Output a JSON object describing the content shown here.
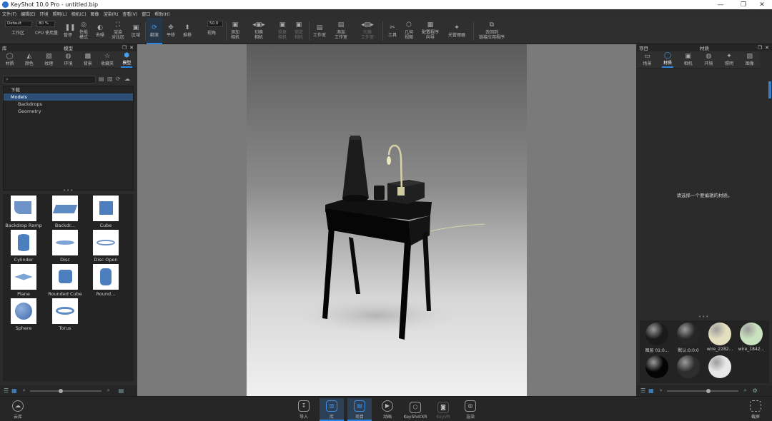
{
  "window": {
    "title": "KeyShot 10.0 Pro  -  untitled.bip",
    "min": "—",
    "max": "❐",
    "close": "✕"
  },
  "menu": [
    "文件(F)",
    "编辑(E)",
    "环境",
    "照明(L)",
    "相机(C)",
    "图像",
    "渲染(R)",
    "查看(V)",
    "窗口",
    "帮助(H)"
  ],
  "toolbar": {
    "workspace_value": "Default",
    "cpu_value": "80 %",
    "focal_value": "50.0",
    "buttons": [
      {
        "label": "工作区",
        "icon": "▭"
      },
      {
        "label": "CPU 使用量",
        "icon": "▮"
      },
      {
        "label": "暂停",
        "icon": "❚❚"
      },
      {
        "label": "性能\n模式",
        "icon": "◎"
      },
      {
        "label": "去噪",
        "icon": "◐"
      },
      {
        "label": "渲染\n对比区",
        "icon": "⛶"
      },
      {
        "label": "区域",
        "icon": "▣"
      },
      {
        "label": "翻滚",
        "icon": "⟳"
      },
      {
        "label": "平移",
        "icon": "✥"
      },
      {
        "label": "推移",
        "icon": "⬍"
      },
      {
        "label": "视角",
        "icon": ""
      },
      {
        "label": "添加\n相机",
        "icon": "▣"
      },
      {
        "label": "切换\n相机",
        "icon": "◂▣▸"
      },
      {
        "label": "恢复\n相机",
        "icon": "▣"
      },
      {
        "label": "锁定\n相机",
        "icon": "▣"
      },
      {
        "label": "工作室",
        "icon": "▤"
      },
      {
        "label": "添加\n工作室",
        "icon": "▤"
      },
      {
        "label": "切换\n工作室",
        "icon": "◂▤▸"
      },
      {
        "label": "工具",
        "icon": "✂"
      },
      {
        "label": "几何\n视图",
        "icon": "⬡"
      },
      {
        "label": "配置程序\n向导",
        "icon": "▦"
      },
      {
        "label": "光管理器",
        "icon": "✦"
      },
      {
        "label": "去回到\n链接应用程序",
        "icon": "⧉"
      }
    ]
  },
  "left_panel": {
    "header_left": "库",
    "header_title": "模型",
    "tabs": [
      {
        "label": "材质",
        "icon": "◯"
      },
      {
        "label": "颜色",
        "icon": "◭"
      },
      {
        "label": "纹理",
        "icon": "▨"
      },
      {
        "label": "环境",
        "icon": "◍"
      },
      {
        "label": "背景",
        "icon": "▩"
      },
      {
        "label": "收藏夹",
        "icon": "☆"
      },
      {
        "label": "模型",
        "icon": "⬢"
      }
    ],
    "tree": [
      {
        "label": "下载",
        "level": 0,
        "selected": false
      },
      {
        "label": "Models",
        "level": 0,
        "selected": true
      },
      {
        "label": "Backdrops",
        "level": 1,
        "selected": false
      },
      {
        "label": "Geometry",
        "level": 1,
        "selected": false
      }
    ],
    "items": [
      "Backdrop Ramp",
      "Backdr...",
      "Cube",
      "Cylinder",
      "Disc",
      "Disc Open",
      "Plane",
      "Rounded Cube",
      "Round...",
      "Sphere",
      "Torus"
    ]
  },
  "right_panel": {
    "header_left": "项目",
    "header_title": "材质",
    "tabs": [
      {
        "label": "场景",
        "icon": "▭"
      },
      {
        "label": "材质",
        "icon": "◯"
      },
      {
        "label": "相机",
        "icon": "▣"
      },
      {
        "label": "环境",
        "icon": "◍"
      },
      {
        "label": "照明",
        "icon": "✦"
      },
      {
        "label": "图像",
        "icon": "▨"
      }
    ],
    "message": "请选择一个要编辑的材质。",
    "materials": [
      {
        "label": "图层 01:0...",
        "color": "#1a1a1a"
      },
      {
        "label": "默认:0:0:0",
        "color": "#262626"
      },
      {
        "label": "wire_2282...",
        "color": "#e4dfbe"
      },
      {
        "label": "wire_1842...",
        "color": "#c9e2c0"
      },
      {
        "label": "",
        "color": "#050505"
      },
      {
        "label": "",
        "color": "#2e2e2e"
      },
      {
        "label": "",
        "color": "#e8e8e8"
      }
    ]
  },
  "bottom": {
    "cloud": "云库",
    "items": [
      {
        "label": "导入",
        "icon": "↧"
      },
      {
        "label": "库",
        "icon": "▥"
      },
      {
        "label": "项目",
        "icon": "▤"
      },
      {
        "label": "动画",
        "icon": "▶"
      },
      {
        "label": "KeyShotXR",
        "icon": "⬡"
      },
      {
        "label": "KeyVR",
        "icon": "◙"
      },
      {
        "label": "渲染",
        "icon": "◎"
      }
    ],
    "screenshot": "截屏"
  },
  "colors": {
    "accent": "#2a86e0",
    "selection": "#2c4f7a",
    "background": "#2b2b2b"
  }
}
